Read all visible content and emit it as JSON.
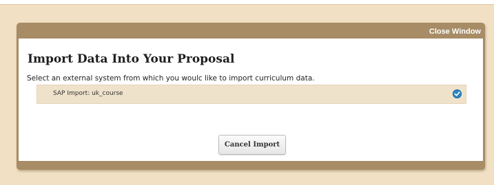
{
  "window": {
    "close_label": "Close Window"
  },
  "dialog": {
    "title": "Import Data Into Your Proposal",
    "instructions": "Select an external system from which you woulc like to import curriculum data.",
    "options": [
      {
        "label": "SAP Import: uk_course",
        "selected": true,
        "icon": "checkmark-circle-icon"
      }
    ],
    "cancel_label": "Cancel Import"
  },
  "colors": {
    "page_background": "#f1e0c3",
    "modal_frame": "#a78c66",
    "option_background": "#efe2cb",
    "check_accent": "#2d86c4"
  }
}
